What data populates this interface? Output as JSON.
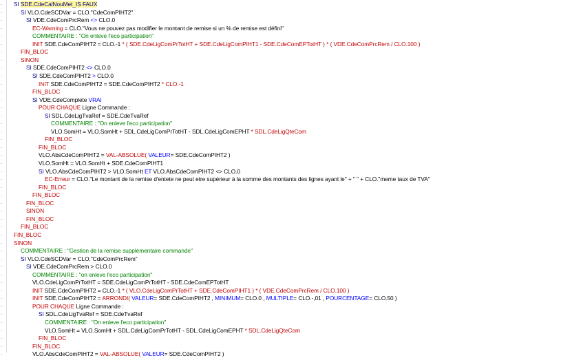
{
  "editor": {
    "lines": [
      {
        "i": 113,
        "segs": [
          {
            "t": "SI ",
            "c": "k"
          },
          {
            "t": "SDE.CdeCalNouMet_IS FAUX",
            "c": "k",
            "h": true
          }
        ]
      },
      {
        "i": 123,
        "segs": [
          {
            "t": "SI ",
            "c": "k"
          },
          {
            "t": "VLO.CdeSCDVar = CLO.\"CdeComPIHT2\"",
            "c": "v"
          }
        ]
      },
      {
        "i": 131,
        "segs": [
          {
            "t": "SI ",
            "c": "k"
          },
          {
            "t": "VDE.CdeComPrcRem ",
            "c": "v"
          },
          {
            "t": "<>",
            "c": "o"
          },
          {
            "t": " CLO.0",
            "c": "v"
          }
        ]
      },
      {
        "i": 140,
        "segs": [
          {
            "t": "EC-Warning",
            "c": "m"
          },
          {
            "t": " = CLO.\"Vous ne pouvez pas modifier le montant de remise si un % de remise est défini\"",
            "c": "v"
          }
        ]
      },
      {
        "i": 140,
        "segs": [
          {
            "t": "COMMENTAIRE : \"On enleve l'eco participation\"",
            "c": "c"
          }
        ]
      },
      {
        "i": 140,
        "segs": [
          {
            "t": "INIT",
            "c": "m"
          },
          {
            "t": " SDE.CdeComPIHT2 = CLO.-1 ",
            "c": "v"
          },
          {
            "t": "* ( SDE.CdeLigComPrTotHT + SDE.CdeLigComPIHT1 - SDE.CdeComEPTotHT ) * ( VDE.CdeComPrcRem / CLO.100 )",
            "c": "m"
          }
        ]
      },
      {
        "i": 123,
        "segs": [
          {
            "t": "FIN_BLOC",
            "c": "m"
          }
        ]
      },
      {
        "i": 123,
        "segs": [
          {
            "t": "SINON",
            "c": "m"
          }
        ]
      },
      {
        "i": 131,
        "segs": [
          {
            "t": "SI ",
            "c": "k"
          },
          {
            "t": "SDE.CdeComPIHT2 ",
            "c": "v"
          },
          {
            "t": "<>",
            "c": "o"
          },
          {
            "t": " CLO.0",
            "c": "v"
          }
        ]
      },
      {
        "i": 140,
        "segs": [
          {
            "t": "SI ",
            "c": "k"
          },
          {
            "t": "SDE.CdeComPIHT2 ",
            "c": "v"
          },
          {
            "t": ">",
            "c": "o"
          },
          {
            "t": " CLO.0",
            "c": "v"
          }
        ]
      },
      {
        "i": 149,
        "segs": [
          {
            "t": "INIT",
            "c": "m"
          },
          {
            "t": " SDE.CdeComPIHT2 = SDE.CdeComPIHT2 ",
            "c": "v"
          },
          {
            "t": "* CLO.-1",
            "c": "m"
          }
        ]
      },
      {
        "i": 140,
        "segs": [
          {
            "t": "FIN_BLOC",
            "c": "m"
          }
        ]
      },
      {
        "i": 140,
        "segs": [
          {
            "t": "SI ",
            "c": "k"
          },
          {
            "t": "VDE.CdeComplete ",
            "c": "v"
          },
          {
            "t": "VRAI",
            "c": "o"
          }
        ]
      },
      {
        "i": 149,
        "segs": [
          {
            "t": "POUR CHAQUE",
            "c": "m"
          },
          {
            "t": " Ligne Commande :",
            "c": "v"
          }
        ]
      },
      {
        "i": 158,
        "segs": [
          {
            "t": "SI ",
            "c": "k"
          },
          {
            "t": "SDL.CdeLigTvaRef = SDE.CdeTvaRef",
            "c": "v"
          }
        ]
      },
      {
        "i": 167,
        "segs": [
          {
            "t": "COMMENTAIRE : \"On enleve l'eco participation\"",
            "c": "c"
          }
        ]
      },
      {
        "i": 167,
        "segs": [
          {
            "t": "VLO.SomHt = VLO.SomHt + SDL.CdeLigComPrTotHT - SDL.CdeLigComEPHT ",
            "c": "v"
          },
          {
            "t": "* SDL.CdeLigQteCom",
            "c": "m"
          }
        ]
      },
      {
        "i": 158,
        "segs": [
          {
            "t": "FIN_BLOC",
            "c": "m"
          }
        ]
      },
      {
        "i": 149,
        "segs": [
          {
            "t": "FIN_BLOC",
            "c": "m"
          }
        ]
      },
      {
        "i": 149,
        "segs": [
          {
            "t": "VLO.AbsCdeComPIHT2 = ",
            "c": "v"
          },
          {
            "t": "VAL-ABSOLUE(",
            "c": "m"
          },
          {
            "t": " VALEUR",
            "c": "o"
          },
          {
            "t": "= SDE.CdeComPIHT2 )",
            "c": "v"
          }
        ]
      },
      {
        "i": 149,
        "segs": [
          {
            "t": "VLO.SomHt = VLO.SomHt + SDE.CdeComPIHT1",
            "c": "v"
          }
        ]
      },
      {
        "i": 149,
        "segs": [
          {
            "t": "SI ",
            "c": "k"
          },
          {
            "t": "VLO.AbsCdeComPIHT2 > VLO.SomHt ",
            "c": "v"
          },
          {
            "t": "ET",
            "c": "o"
          },
          {
            "t": " VLO.AbsCdeComPIHT2 <> CLO.0",
            "c": "v"
          }
        ]
      },
      {
        "i": 158,
        "segs": [
          {
            "t": "EC-Erreur",
            "c": "m"
          },
          {
            "t": " = CLO.\"Le montant de la remise d'entete ne peut etre supérieur à la somme des montants des lignes ayant le\" + \" \" + CLO.\"meme taux de TVA\"",
            "c": "v"
          }
        ]
      },
      {
        "i": 149,
        "segs": [
          {
            "t": "FIN_BLOC",
            "c": "m"
          }
        ]
      },
      {
        "i": 140,
        "segs": [
          {
            "t": "FIN_BLOC",
            "c": "m"
          }
        ]
      },
      {
        "i": 131,
        "segs": [
          {
            "t": "FIN_BLOC",
            "c": "m"
          }
        ]
      },
      {
        "i": 131,
        "segs": [
          {
            "t": "SINON",
            "c": "m"
          }
        ]
      },
      {
        "i": 131,
        "segs": [
          {
            "t": "FIN_BLOC",
            "c": "m"
          }
        ]
      },
      {
        "i": 123,
        "segs": [
          {
            "t": "FIN_BLOC",
            "c": "m"
          }
        ]
      },
      {
        "i": 113,
        "segs": [
          {
            "t": "FIN_BLOC",
            "c": "m"
          }
        ]
      },
      {
        "i": 113,
        "segs": [
          {
            "t": "SINON",
            "c": "m"
          }
        ]
      },
      {
        "i": 123,
        "segs": [
          {
            "t": "COMMENTAIRE : \"Gestion de la remise supplémentaire commande\"",
            "c": "c"
          }
        ]
      },
      {
        "i": 123,
        "segs": [
          {
            "t": "SI ",
            "c": "k"
          },
          {
            "t": "VLO.CdeSCDVar = CLO.\"CdeComPrcRem\"",
            "c": "v"
          }
        ]
      },
      {
        "i": 131,
        "segs": [
          {
            "t": "SI ",
            "c": "k"
          },
          {
            "t": "VDE.CdeComPrcRem > CLO.0",
            "c": "v"
          }
        ]
      },
      {
        "i": 140,
        "segs": [
          {
            "t": "COMMENTAIRE : \"on enleve l'eco participation\"",
            "c": "c"
          }
        ]
      },
      {
        "i": 140,
        "segs": [
          {
            "t": "VLO.CdeLigComPrTotHT = SDE.CdeLigComPrTotHT - SDE.CdeComEPTotHT",
            "c": "v"
          }
        ]
      },
      {
        "i": 140,
        "segs": [
          {
            "t": "INIT",
            "c": "m"
          },
          {
            "t": " SDE.CdeComPIHT2 = CLO.-1 ",
            "c": "v"
          },
          {
            "t": "* ( VLO.CdeLigComPrTotHT + SDE.CdeComPIHT1 ) * ( VDE.CdeComPrcRem / CLO.100 )",
            "c": "m"
          }
        ]
      },
      {
        "i": 140,
        "segs": [
          {
            "t": "INIT",
            "c": "m"
          },
          {
            "t": " SDE.CdeComPIHT2 = ",
            "c": "v"
          },
          {
            "t": "ARRONDI(",
            "c": "m"
          },
          {
            "t": " VALEUR",
            "c": "o"
          },
          {
            "t": "= SDE.CdeComPIHT2 , ",
            "c": "v"
          },
          {
            "t": "MINIMUM",
            "c": "o"
          },
          {
            "t": "= CLO.0 , ",
            "c": "v"
          },
          {
            "t": "MULTIPLE",
            "c": "o"
          },
          {
            "t": "= CLO.-,01 , ",
            "c": "v"
          },
          {
            "t": "POURCENTAGE",
            "c": "o"
          },
          {
            "t": "= CLO.50 )",
            "c": "v"
          }
        ]
      },
      {
        "i": 140,
        "segs": [
          {
            "t": "POUR CHAQUE",
            "c": "m"
          },
          {
            "t": " Ligne Commande :",
            "c": "v"
          }
        ]
      },
      {
        "i": 149,
        "segs": [
          {
            "t": "SI ",
            "c": "k"
          },
          {
            "t": "SDL.CdeLigTvaRef = SDE.CdeTvaRef",
            "c": "v"
          }
        ]
      },
      {
        "i": 158,
        "segs": [
          {
            "t": "COMMENTAIRE : \"On enleve l'eco participation\"",
            "c": "c"
          }
        ]
      },
      {
        "i": 158,
        "segs": [
          {
            "t": "VLO.SomHt = VLO.SomHt + SDL.CdeLigComPrTotHT - SDL.CdeLigComEPHT ",
            "c": "v"
          },
          {
            "t": "* SDL.CdeLigQteCom",
            "c": "m"
          }
        ]
      },
      {
        "i": 149,
        "segs": [
          {
            "t": "FIN_BLOC",
            "c": "m"
          }
        ]
      },
      {
        "i": 140,
        "segs": [
          {
            "t": "FIN_BLOC",
            "c": "m"
          }
        ]
      },
      {
        "i": 140,
        "segs": [
          {
            "t": "VLO.AbsCdeComPIHT2 = ",
            "c": "v"
          },
          {
            "t": "VAL-ABSOLUE(",
            "c": "m"
          },
          {
            "t": " VALEUR",
            "c": "o"
          },
          {
            "t": "= SDE.CdeComPIHT2 )",
            "c": "v"
          }
        ]
      }
    ]
  }
}
